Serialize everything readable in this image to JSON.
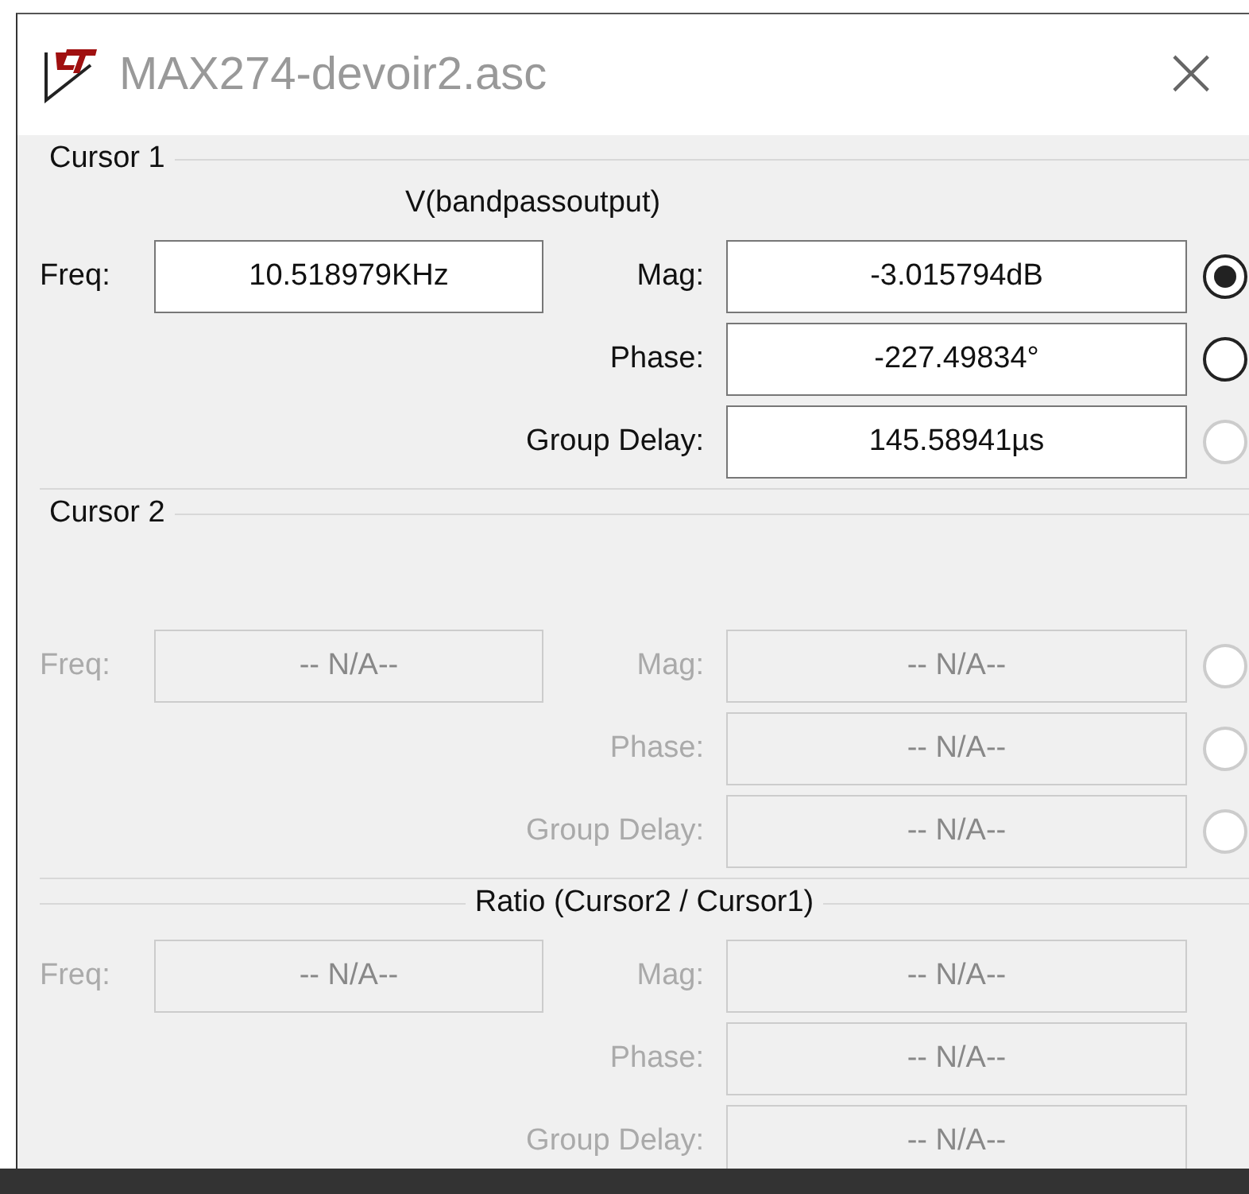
{
  "window": {
    "title": "MAX274-devoir2.asc",
    "close": "×"
  },
  "sections": [
    {
      "title": "Cursor 1",
      "kind": "cursor",
      "signal": "V(bandpassoutput)",
      "disabled": false,
      "freq": {
        "label": "Freq:",
        "value": "10.518979KHz"
      },
      "rows": [
        {
          "label": "Mag:",
          "value": "-3.015794dB",
          "radio": {
            "selected": true,
            "disabled": false
          }
        },
        {
          "label": "Phase:",
          "value": "-227.49834°",
          "radio": {
            "selected": false,
            "disabled": false
          }
        },
        {
          "label": "Group Delay:",
          "value": "145.58941µs",
          "radio": {
            "selected": false,
            "disabled": true
          }
        }
      ]
    },
    {
      "title": "Cursor 2",
      "kind": "cursor",
      "disabled": true,
      "freq": {
        "label": "Freq:",
        "value": "-- N/A--"
      },
      "rows": [
        {
          "label": "Mag:",
          "value": "-- N/A--",
          "radio": {
            "selected": false,
            "disabled": true
          }
        },
        {
          "label": "Phase:",
          "value": "-- N/A--",
          "radio": {
            "selected": false,
            "disabled": true
          }
        },
        {
          "label": "Group Delay:",
          "value": "-- N/A--",
          "radio": {
            "selected": false,
            "disabled": true
          }
        }
      ]
    },
    {
      "title": "Ratio (Cursor2 / Cursor1)",
      "kind": "ratio",
      "disabled": true,
      "freq": {
        "label": "Freq:",
        "value": "-- N/A--"
      },
      "rows": [
        {
          "label": "Mag:",
          "value": "-- N/A--"
        },
        {
          "label": "Phase:",
          "value": "-- N/A--"
        },
        {
          "label": "Group Delay:",
          "value": "-- N/A--"
        }
      ]
    }
  ]
}
